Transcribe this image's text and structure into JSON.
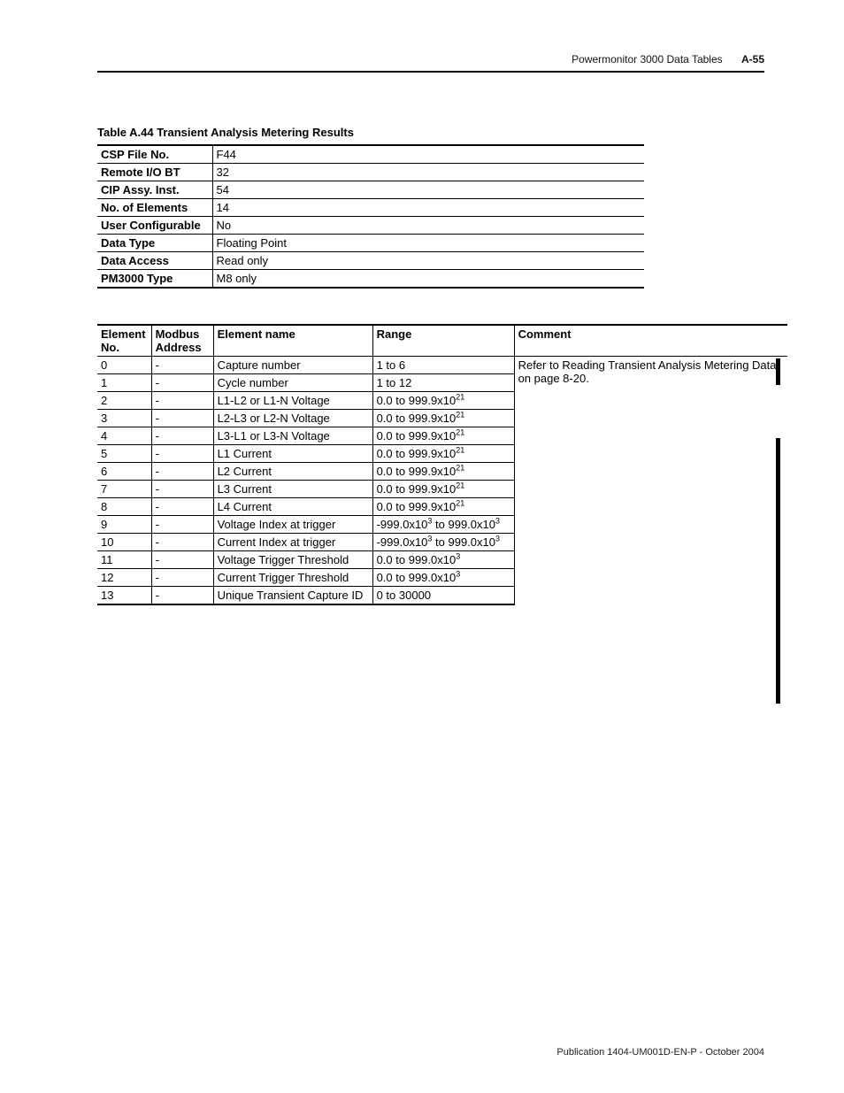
{
  "header": {
    "doc_title": "Powermonitor 3000 Data Tables",
    "page_ref": "A-55"
  },
  "table_title": "Table A.44 Transient Analysis Metering Results",
  "meta": [
    {
      "label": "CSP File No.",
      "value": "F44"
    },
    {
      "label": "Remote I/O BT",
      "value": "32"
    },
    {
      "label": "CIP Assy. Inst.",
      "value": "54"
    },
    {
      "label": "No. of Elements",
      "value": "14"
    },
    {
      "label": "User Configurable",
      "value": "No"
    },
    {
      "label": "Data Type",
      "value": "Floating Point"
    },
    {
      "label": "Data Access",
      "value": "Read only"
    },
    {
      "label": "PM3000 Type",
      "value": "M8 only"
    }
  ],
  "columns": {
    "no": "Element No.",
    "mod": "Modbus Address",
    "name": "Element name",
    "range": "Range",
    "comment": "Comment"
  },
  "comment_text": "Refer to Reading Transient Analysis Metering Data on page 8-20.",
  "rows": [
    {
      "no": "0",
      "mod": "-",
      "name": "Capture number",
      "range_html": "1 to 6"
    },
    {
      "no": "1",
      "mod": "-",
      "name": "Cycle number",
      "range_html": "1 to 12"
    },
    {
      "no": "2",
      "mod": "-",
      "name": "L1-L2 or L1-N Voltage",
      "range_html": "0.0 to 999.9x10<sup>21</sup>"
    },
    {
      "no": "3",
      "mod": "-",
      "name": "L2-L3 or L2-N Voltage",
      "range_html": "0.0 to 999.9x10<sup>21</sup>"
    },
    {
      "no": "4",
      "mod": "-",
      "name": "L3-L1 or L3-N Voltage",
      "range_html": "0.0 to 999.9x10<sup>21</sup>"
    },
    {
      "no": "5",
      "mod": "-",
      "name": "L1 Current",
      "range_html": "0.0 to 999.9x10<sup>21</sup>"
    },
    {
      "no": "6",
      "mod": "-",
      "name": "L2 Current",
      "range_html": "0.0 to 999.9x10<sup>21</sup>"
    },
    {
      "no": "7",
      "mod": "-",
      "name": "L3 Current",
      "range_html": "0.0 to 999.9x10<sup>21</sup>"
    },
    {
      "no": "8",
      "mod": "-",
      "name": "L4 Current",
      "range_html": "0.0 to 999.9x10<sup>21</sup>"
    },
    {
      "no": "9",
      "mod": "-",
      "name": "Voltage Index at trigger",
      "range_html": "-999.0x10<sup>3</sup> to 999.0x10<sup>3</sup>"
    },
    {
      "no": "10",
      "mod": "-",
      "name": "Current Index at trigger",
      "range_html": "-999.0x10<sup>3</sup> to 999.0x10<sup>3</sup>"
    },
    {
      "no": "11",
      "mod": "-",
      "name": "Voltage Trigger Threshold",
      "range_html": "0.0 to 999.0x10<sup>3</sup>"
    },
    {
      "no": "12",
      "mod": "-",
      "name": "Current Trigger Threshold",
      "range_html": "0.0 to 999.0x10<sup>3</sup>"
    },
    {
      "no": "13",
      "mod": "-",
      "name": "Unique Transient Capture ID",
      "range_html": "0 to 30000"
    }
  ],
  "footer": "Publication 1404-UM001D-EN-P - October 2004"
}
